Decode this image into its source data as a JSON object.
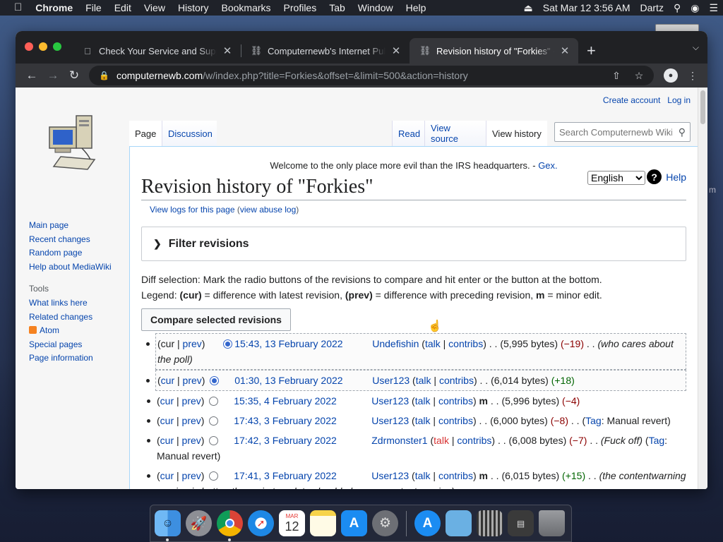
{
  "menubar": {
    "apple_icon": "apple-icon",
    "app": "Chrome",
    "items": [
      "File",
      "Edit",
      "View",
      "History",
      "Bookmarks",
      "Profiles",
      "Tab",
      "Window",
      "Help"
    ],
    "datetime": "Sat Mar 12  3:56 AM",
    "user": "Dartz"
  },
  "tabs": [
    {
      "title": "Check Your Service and Suppo",
      "icon": "apple-icon",
      "active": false
    },
    {
      "title": "Computernewb's Internet Pub",
      "icon": "wiki-icon",
      "active": false
    },
    {
      "title": "Revision history of \"Forkies\" - C",
      "icon": "wiki-icon",
      "active": true
    }
  ],
  "toolbar": {
    "url_host": "computernewb.com",
    "url_path": "/w/index.php?title=Forkies&offset=&limit=500&action=history"
  },
  "personal": {
    "create_account": "Create account",
    "login": "Log in"
  },
  "nav": {
    "main": [
      "Main page",
      "Recent changes",
      "Random page",
      "Help about MediaWiki"
    ],
    "tools_heading": "Tools",
    "tools": [
      "What links here",
      "Related changes",
      "Atom",
      "Special pages",
      "Page information"
    ]
  },
  "page_tabs": {
    "page": "Page",
    "discussion": "Discussion",
    "read": "Read",
    "view_source": "View source",
    "view_history": "View history"
  },
  "search": {
    "placeholder": "Search Computernewb Wiki"
  },
  "sitenotice": {
    "text": "Welcome to the only place more evil than the IRS headquarters. - ",
    "link": "Gex."
  },
  "title": "Revision history of \"Forkies\"",
  "language": {
    "selected": "English"
  },
  "help_label": "Help",
  "subtitle": {
    "logs": "View logs for this page",
    "open": " (",
    "abuse": "view abuse log",
    "close": ")"
  },
  "filter_label": "Filter revisions",
  "explain": {
    "line1": "Diff selection: Mark the radio buttons of the revisions to compare and hit enter or the button at the bottom.",
    "legend_label": "Legend: ",
    "cur_b": "(cur)",
    "cur_t": " = difference with latest revision, ",
    "prev_b": "(prev)",
    "prev_t": " = difference with preceding revision, ",
    "m_b": "m",
    "m_t": " = minor edit."
  },
  "compare_button": "Compare selected revisions",
  "links": {
    "cur": "cur",
    "prev": "prev",
    "talk": "talk",
    "contribs": "contribs",
    "tag": "Tag"
  },
  "revisions": [
    {
      "date": "15:43, 13 February 2022",
      "user": "Undefishin",
      "minor": "",
      "size": "(5,995 bytes)",
      "diff": "(−19)",
      "diff_sign": "neg",
      "comment": "(who cares about the poll)",
      "tag": "",
      "cur_link": false,
      "prev_link": true,
      "radio_old": false,
      "radio_new": true,
      "selected": true
    },
    {
      "date": "01:30, 13 February 2022",
      "user": "User123",
      "minor": "",
      "size": "(6,014 bytes)",
      "diff": "(+18)",
      "diff_sign": "pos",
      "comment": "",
      "tag": "",
      "cur_link": true,
      "prev_link": true,
      "radio_old": true,
      "radio_new": false,
      "selected": true
    },
    {
      "date": "15:35, 4 February 2022",
      "user": "User123",
      "minor": "m",
      "size": "(5,996 bytes)",
      "diff": "(−4)",
      "diff_sign": "neg",
      "comment": "",
      "tag": "",
      "cur_link": true,
      "prev_link": true,
      "radio_old": false,
      "radio_new": false,
      "selected": false
    },
    {
      "date": "17:43, 3 February 2022",
      "user": "User123",
      "minor": "",
      "size": "(6,000 bytes)",
      "diff": "(−8)",
      "diff_sign": "neg",
      "comment": "",
      "tag": "Manual revert",
      "cur_link": true,
      "prev_link": true,
      "radio_old": false,
      "radio_new": false,
      "selected": false
    },
    {
      "date": "17:42, 3 February 2022",
      "user": "Zdrmonster1",
      "minor": "",
      "size": "(6,008 bytes)",
      "diff": "(−7)",
      "diff_sign": "neg",
      "comment": "(Fuck off)",
      "tag": "Manual revert",
      "user_red_talk": true,
      "cur_link": true,
      "prev_link": true,
      "radio_old": false,
      "radio_new": false,
      "selected": false
    },
    {
      "date": "17:41, 3 February 2022",
      "user": "User123",
      "minor": "m",
      "size": "(6,015 bytes)",
      "diff": "(+15)",
      "diff_sign": "pos",
      "comment": "(the contentwarning version is better, the main template should also use contentwarning)",
      "tag": "",
      "cur_link": true,
      "prev_link": true,
      "radio_old": false,
      "radio_new": false,
      "selected": false
    }
  ],
  "dock": [
    "Finder",
    "Launchpad",
    "Chrome",
    "Safari",
    "Calendar",
    "Notes",
    "App Store",
    "System Preferences",
    "App Store Downloads",
    "Folder",
    "Window Grid",
    "Screen Capture",
    "Trash"
  ],
  "calendar": {
    "month": "MAR",
    "day": "12"
  }
}
